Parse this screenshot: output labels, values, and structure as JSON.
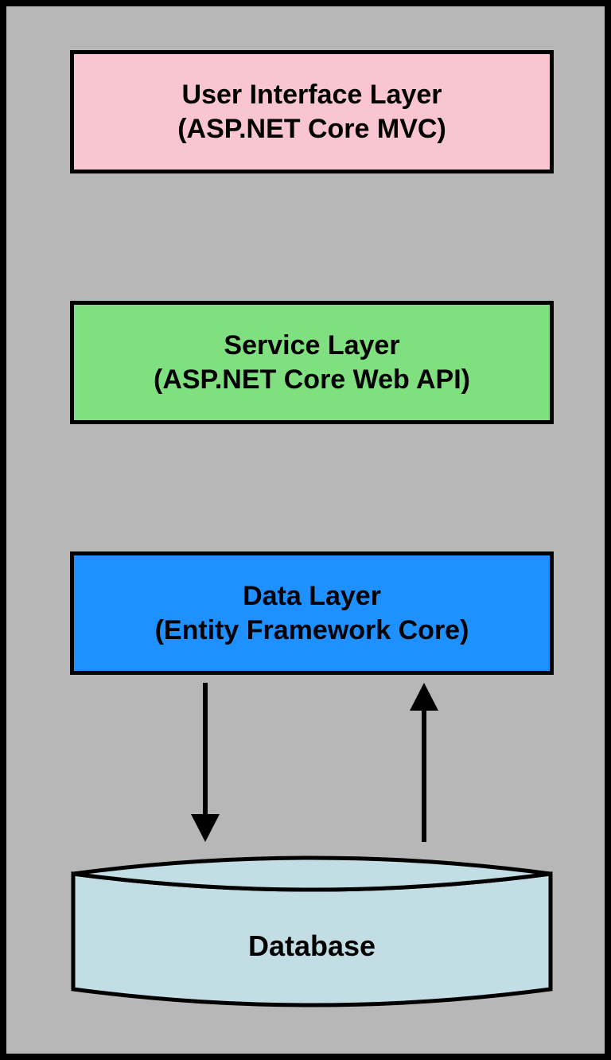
{
  "layers": {
    "ui": {
      "title": "User Interface Layer",
      "subtitle": "(ASP.NET Core MVC)",
      "color": "#f9c5d0"
    },
    "service": {
      "title": "Service Layer",
      "subtitle": "(ASP.NET Core Web API)",
      "color": "#80e080"
    },
    "data": {
      "title": "Data Layer",
      "subtitle": "(Entity Framework Core)",
      "color": "#1e90ff"
    }
  },
  "database": {
    "label": "Database",
    "fill": "#c3dde5"
  }
}
